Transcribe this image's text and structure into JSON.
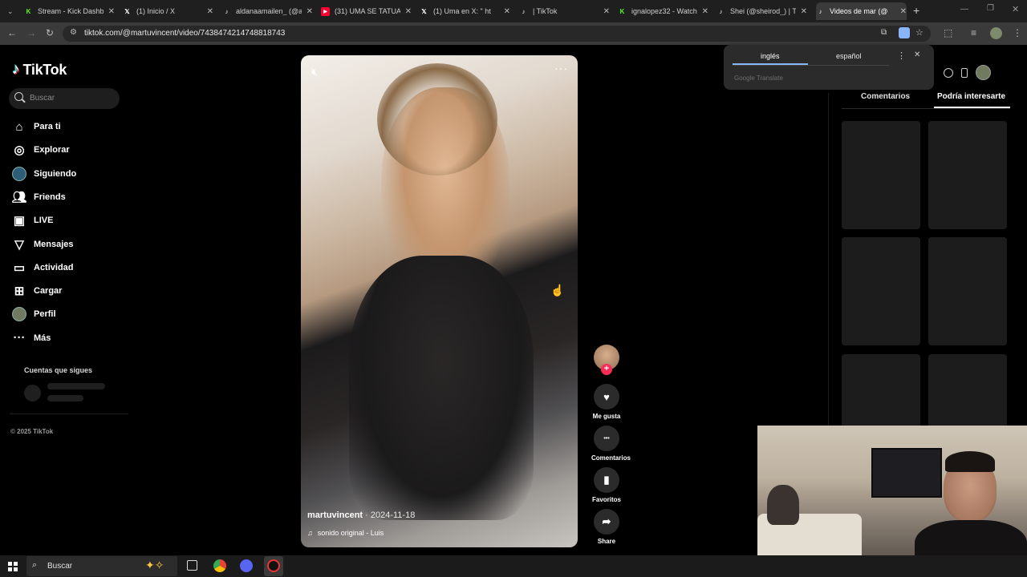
{
  "browser": {
    "tabs": [
      {
        "title": "Stream - Kick Dashb",
        "icon": "kick-icon",
        "color": "#53fc18"
      },
      {
        "title": "(1) Inicio / X",
        "icon": "x-icon",
        "color": "#ffffff"
      },
      {
        "title": "aldanaamailen_ (@ak",
        "icon": "tiktok-icon",
        "color": "#ffffff"
      },
      {
        "title": "(31) UMA SE TATUA",
        "icon": "youtube-icon",
        "color": "#ff0033"
      },
      {
        "title": "(1) Uma en X: \" ht",
        "icon": "x-icon",
        "color": "#ffffff"
      },
      {
        "title": "| TikTok",
        "icon": "tiktok-icon",
        "color": "#ffffff"
      },
      {
        "title": "ignalopez32 - Watch",
        "icon": "kick-icon",
        "color": "#53fc18"
      },
      {
        "title": "Shei (@sheirod_) | T",
        "icon": "tiktok-icon",
        "color": "#ffffff"
      },
      {
        "title": "Videos de mar (@",
        "icon": "tiktok-icon",
        "color": "#ffffff"
      }
    ],
    "url": "tiktok.com/@martuvincent/video/7438474214748818743"
  },
  "translate_popup": {
    "lang_from": "inglés",
    "lang_to": "español",
    "provider": "Google Translate"
  },
  "sidebar": {
    "logo": "TikTok",
    "search_placeholder": "Buscar",
    "items": [
      {
        "label": "Para ti",
        "icon": "home-icon"
      },
      {
        "label": "Explorar",
        "icon": "compass-icon"
      },
      {
        "label": "Siguiendo",
        "icon": "following-icon"
      },
      {
        "label": "Friends",
        "icon": "friends-icon"
      },
      {
        "label": "LIVE",
        "icon": "live-icon"
      },
      {
        "label": "Mensajes",
        "icon": "send-icon"
      },
      {
        "label": "Actividad",
        "icon": "activity-icon"
      },
      {
        "label": "Cargar",
        "icon": "upload-icon"
      },
      {
        "label": "Perfil",
        "icon": "avatar-icon"
      },
      {
        "label": "Más",
        "icon": "more-icon"
      }
    ],
    "following_title": "Cuentas que sigues",
    "copyright": "© 2025 TikTok"
  },
  "video": {
    "username": "martuvincent",
    "date": "· 2024-11-18",
    "sound": "sonido original - Luis"
  },
  "actions": [
    {
      "label": "Me gusta",
      "icon": "heart-icon"
    },
    {
      "label": "Comentarios",
      "icon": "comment-icon"
    },
    {
      "label": "Favoritos",
      "icon": "bookmark-icon"
    },
    {
      "label": "Share",
      "icon": "share-icon"
    }
  ],
  "right_panel": {
    "tab_comments": "Comentarios",
    "tab_suggested": "Podría interesarte"
  },
  "taskbar": {
    "search_placeholder": "Buscar"
  }
}
